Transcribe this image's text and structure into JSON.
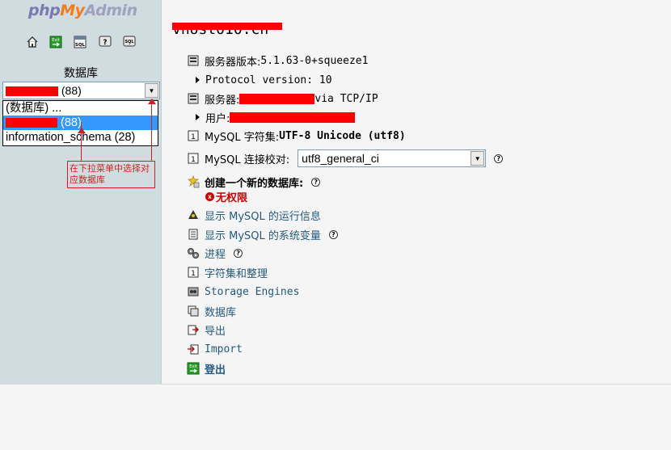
{
  "left": {
    "logo": {
      "php": "php",
      "my": "My",
      "admin": "Admin"
    },
    "nav_icons": [
      "home-icon",
      "exit-icon",
      "sql-icon",
      "help-doc-icon",
      "sql-doc-icon"
    ],
    "db_label": "数据库",
    "db_select": {
      "count_text": " (88)"
    },
    "db_options": [
      {
        "text": "(数据库) ..."
      },
      {
        "text": " (88)",
        "selected": true
      },
      {
        "text": "information_schema (28)"
      }
    ],
    "annotation": "在下拉菜单中选择对应数据库"
  },
  "right": {
    "server_title": "vhost010.cn",
    "server_version_label": "服务器版本: ",
    "server_version_value": "5.1.63-0+squeeze1",
    "protocol_text": "Protocol version: 10",
    "server_label": "服务器: ",
    "server_via": " via TCP/IP",
    "user_label": "用户: ",
    "charset_label": "MySQL 字符集: ",
    "charset_value": "UTF-8 Unicode (utf8)",
    "collation_label": "MySQL 连接校对: ",
    "collation_value": "utf8_general_ci",
    "create_db_label": "创建一个新的数据库: ",
    "no_permission": "无权限",
    "links": {
      "runtime": "显示 MySQL 的运行信息",
      "variables": "显示 MySQL 的系统变量",
      "processes": "进程",
      "charsets": "字符集和整理",
      "engines": "Storage Engines",
      "databases": "数据库",
      "export": "导出",
      "import": "Import",
      "logout": "登出"
    }
  },
  "colors": {
    "link": "#235a81",
    "left_bg": "#d0dce0",
    "selected": "#3399ff",
    "annotation": "#d02020",
    "no_permission": "#cc0000"
  }
}
